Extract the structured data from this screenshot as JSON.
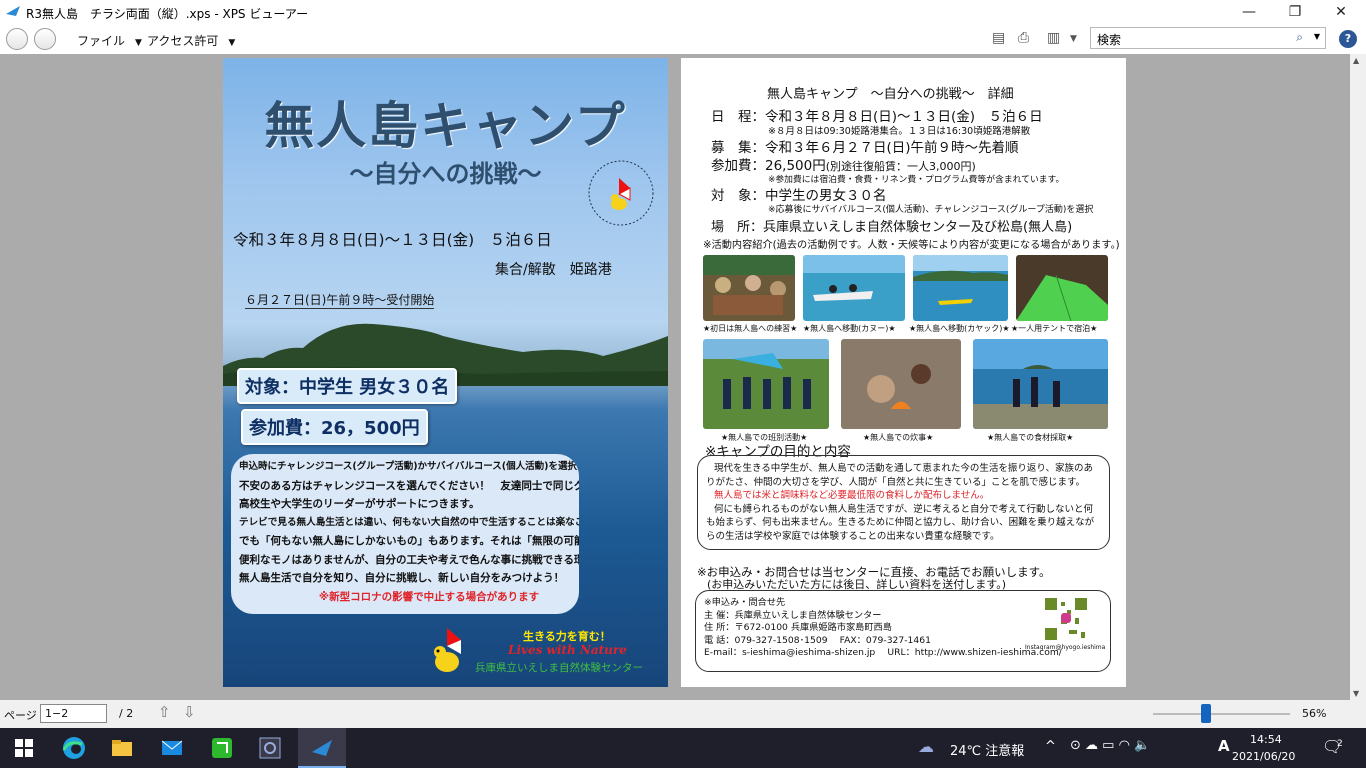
{
  "window": {
    "title": "R3無人島　チラシ両面（縦）.xps - XPS ビューアー",
    "controls": [
      "—",
      "❐",
      "✕"
    ]
  },
  "menu": {
    "file": "ファイル",
    "access": "アクセス許可",
    "search_placeholder": "検索"
  },
  "page1": {
    "title": "無人島キャンプ",
    "subtitle": "〜自分への挑戦〜",
    "dates": "令和３年８月８日(日)〜１３日(金)　５泊６日",
    "meet": "集合/解散　姫路港",
    "start": "６月２７日(日)午前９時〜受付開始",
    "target": "対象：中学生 男女３０名",
    "fee": "参加費：26，500円",
    "info_lines": [
      "申込時にチャレンジコース(グループ活動)かサバイバルコース(個人活動)を選択してもらいます。",
      "不安のある方はチャレンジコースを選んでください！　友達同士で同じグループもOK！",
      "高校生や大学生のリーダーがサポートにつきます。",
      "テレビで見る無人島生活とは違い、何もない大自然の中で生活することは楽なことではありません。",
      "でも「何もない無人島にしかないもの」もあります。それは「無限の可能性」です。",
      "便利なモノはありませんが、自分の工夫や考えで色んな事に挑戦できる環境があります。",
      "無人島生活で自分を知り、自分に挑戦し、新しい自分をみつけよう！"
    ],
    "corona": "※新型コロナの影響で中止する場合があります",
    "logo_tagline": "生きる力を育む！",
    "logo_name": "Lives with Nature",
    "logo_center": "兵庫県立いえしま自然体験センター"
  },
  "page2": {
    "heading": "無人島キャンプ　〜自分への挑戦〜　詳細",
    "rows": [
      {
        "label": "日　程：",
        "value": "令和３年８月８日(日)〜１３日(金)　５泊６日",
        "note": "※８月８日は09:30姫路港集合。１３日は16:30頃姫路港解散"
      },
      {
        "label": "募　集：",
        "value": "令和３年６月２７日(日)午前９時〜先着順",
        "note": ""
      },
      {
        "label": "参加費：",
        "value": "26,500円",
        "value_small": "(別途往復船賃：一人3,000円)",
        "note": "※参加費には宿泊費・食費・リネン費・プログラム費等が含まれています。"
      },
      {
        "label": "対　象：",
        "value": "中学生の男女３０名",
        "note": "※応募後にサバイバルコース(個人活動)、チャレンジコース(グループ活動)を選択"
      },
      {
        "label": "場　所：",
        "value": "兵庫県立いえしま自然体験センター及び松島(無人島)",
        "note": ""
      }
    ],
    "activity_note": "※活動内容紹介(過去の活動例です。人数・天候等により内容が変更になる場合があります。)",
    "captions_row1": [
      "★初日は無人島への練習★",
      "★無人島へ移動(カヌー)★",
      "★無人島へ移動(カヤック)★",
      "★一人用テントで宿泊★"
    ],
    "captions_row2": [
      "★無人島での班別活動★",
      "★無人島での炊事★",
      "★無人島での食材採取★"
    ],
    "purpose_heading": "※キャンプの目的と内容",
    "purpose_lines": [
      "現代を生きる中学生が、無人島での活動を通して恵まれた今の生活を振り返り、家族のあ",
      "りがたさ、仲間の大切さを学び、人間が「自然と共に生きている」ことを肌で感じます。",
      "何にも縛られるものがない無人島生活ですが、逆に考えると自分で考えて行動しないと何",
      "も始まらず、何も出来ません。生きるために仲間と協力し、助け合い、困難を乗り越えなが",
      "らの生活は学校や家庭では体験することの出来ない貴重な経験です。"
    ],
    "purpose_red": "無人島では米と調味料など必要最低限の食料しか配布しません。",
    "apply_line1": "※お申込み・お問合せは当センターに直接、お電話でお願いします。",
    "apply_line2": "(お申込みいただいた方には後日、詳しい資料を送付します。)",
    "contact_lines": [
      "※申込み・問合せ先",
      "主 催：兵庫県立いえしま自然体験センター",
      "住 所：〒672-0100 兵庫県姫路市家島町西島",
      "電 話：079-327-1508･1509　 FAX：079-327-1461",
      "E-mail：s-ieshima@ieshima-shizen.jp　 URL：http://www.shizen-ieshima.com/"
    ],
    "instagram": "Instagram@hyogo.ieshima"
  },
  "status": {
    "page_label": "ページ",
    "page_value": "1−2",
    "page_total": "/ 2",
    "zoom": "56%",
    "zoom_level": 0.56
  },
  "taskbar": {
    "weather": "24℃ 注意報",
    "time": "14:54",
    "date": "2021/06/20",
    "notif": "2"
  }
}
